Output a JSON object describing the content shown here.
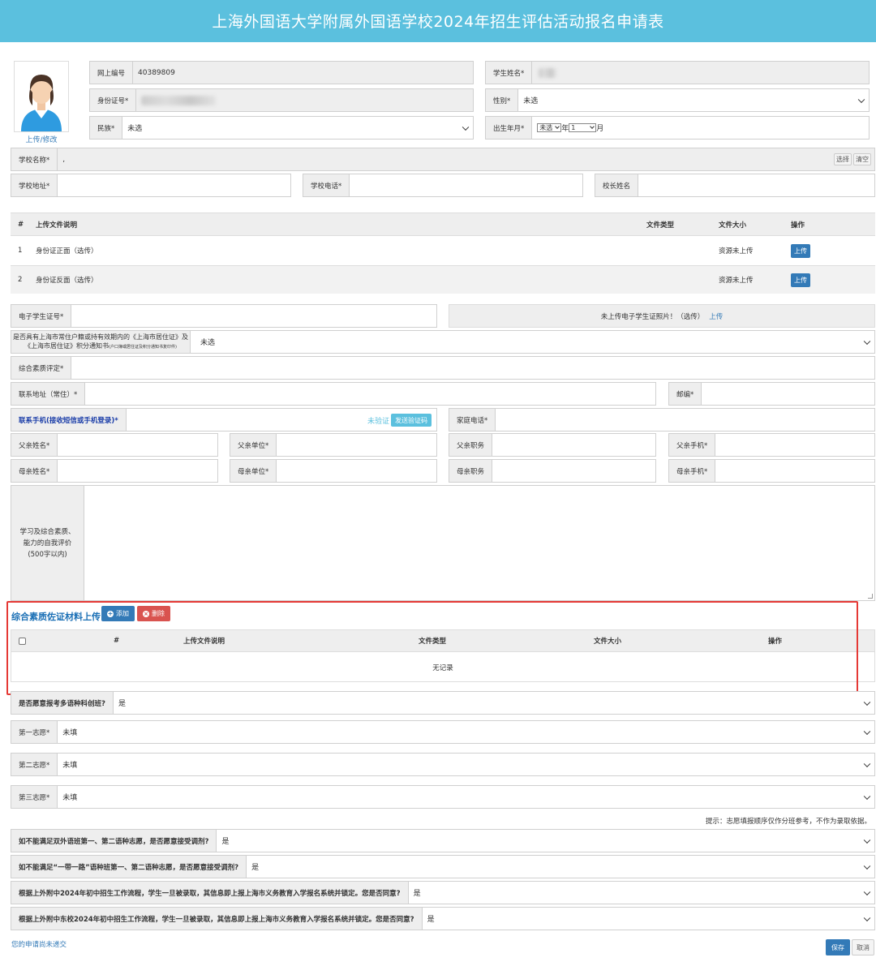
{
  "header": {
    "title": "上海外国语大学附属外国语学校2024年招生评估活动报名申请表"
  },
  "avatar": {
    "upload_label": "上传/修改"
  },
  "basic": {
    "online_no_label": "网上编号",
    "online_no_value": "40389809",
    "student_name_label": "学生姓名*",
    "id_label": "身份证号*",
    "gender_label": "性别*",
    "gender_value": "未选",
    "ethnic_label": "民族*",
    "ethnic_value": "未选",
    "birth_label": "出生年月*",
    "birth_year": "未选",
    "birth_year_suffix": "年",
    "birth_month": "1",
    "birth_month_suffix": "月"
  },
  "school": {
    "name_label": "学校名称*",
    "name_value": ",",
    "select_btn": "选择",
    "clear_btn": "清空",
    "address_label": "学校地址*",
    "phone_label": "学校电话*",
    "principal_label": "校长姓名"
  },
  "files_table": {
    "headers": {
      "num": "#",
      "desc": "上传文件说明",
      "type": "文件类型",
      "size": "文件大小",
      "action": "操作"
    },
    "rows": [
      {
        "num": "1",
        "desc": "身份证正面（选传）",
        "size": "资源未上传",
        "action": "上传"
      },
      {
        "num": "2",
        "desc": "身份证反面（选传）",
        "size": "资源未上传",
        "action": "上传"
      }
    ]
  },
  "student_card": {
    "label": "电子学生证号*",
    "photo_text": "未上传电子学生证照片！（选传）",
    "photo_link": "上传"
  },
  "residence": {
    "label_line1": "是否具有上海市常住户籍或持有效期内的《上海市居住证》及",
    "label_line2": "《上海市居住证》积分通知书",
    "label_small": "(户口簿或居住证及积分通知书复印件)",
    "value": "未选"
  },
  "quality": {
    "label": "综合素质评定*"
  },
  "contact": {
    "address_label": "联系地址（常住）*",
    "zip_label": "邮编*",
    "mobile_label": "联系手机(接收短信或手机登录)*",
    "verify_status": "未验证",
    "send_code_btn": "发送验证码",
    "home_phone_label": "家庭电话*"
  },
  "parents": {
    "father_name": "父亲姓名*",
    "father_org": "父亲单位*",
    "father_job": "父亲职务",
    "father_mobile": "父亲手机*",
    "mother_name": "母亲姓名*",
    "mother_org": "母亲单位*",
    "mother_job": "母亲职务",
    "mother_mobile": "母亲手机*"
  },
  "self_eval": {
    "line1": "学习及综合素质、",
    "line2": "能力的自我评价",
    "line3": "(500字以内)"
  },
  "evidence": {
    "title": "综合素质佐证材料上传",
    "add_btn": "添加",
    "delete_btn": "删除",
    "headers": {
      "num": "#",
      "desc": "上传文件说明",
      "type": "文件类型",
      "size": "文件大小",
      "action": "操作"
    },
    "empty": "无记录"
  },
  "choices": {
    "multi_lang_label": "是否愿意报考多语种科创班?",
    "multi_lang_value": "是",
    "first_label": "第一志愿*",
    "first_value": "未填",
    "second_label": "第二志愿*",
    "second_value": "未填",
    "third_label": "第三志愿*",
    "third_value": "未填",
    "hint": "提示：志愿填报顺序仅作分班参考，不作为录取依据。",
    "q1_label": "如不能满足双外语班第一、第二语种志愿，是否愿意接受调剂?",
    "q1_value": "是",
    "q2_label": "如不能满足“一带一路”语种班第一、第二语种志愿，是否愿意接受调剂?",
    "q2_value": "是",
    "q3_label": "根据上外附中2024年初中招生工作流程，学生一旦被录取，其信息即上报上海市义务教育入学报名系统并锁定。您是否同意?",
    "q3_value": "是",
    "q4_label": "根据上外附中东校2024年初中招生工作流程，学生一旦被录取，其信息即上报上海市义务教育入学报名系统并锁定。您是否同意?",
    "q4_value": "是"
  },
  "footer": {
    "status": "您的申请尚未递交",
    "save_btn": "保存",
    "cancel_btn": "取消"
  },
  "colors": {
    "header_bg": "#5bc0de",
    "primary": "#337ab7",
    "danger": "#d9534f",
    "highlight": "#e53935"
  }
}
